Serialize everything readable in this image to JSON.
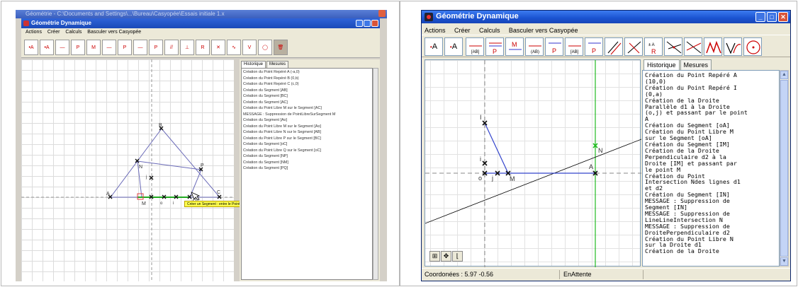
{
  "left": {
    "outer_title": "Géométrie - C:\\Documents and Settings\\...\\Bureau\\Casyopée\\Essais initiale 1.x",
    "window_title": "Géométrie Dynamique",
    "menu": [
      "Actions",
      "Créer",
      "Calculs",
      "Basculer vers Casyopée"
    ],
    "tabs": [
      "Historique",
      "Mesures"
    ],
    "history": [
      "Création du Point Repéré A (-a,0)",
      "Création du Point Repéré B (0,b)",
      "Création du Point Repéré C (c,0)",
      "Création du Segment [AB]",
      "Création du Segment [BC]",
      "Création du Segment [AC]",
      "Création du Point Libre M sur le Segment [AC]",
      "MESSAGE : Suppression de PointLibreSurSegment M",
      "Création du Segment [Ao]",
      "Création du Point Libre M sur le Segment [Ao]",
      "Création du Point Libre N sur le Segment [AB]",
      "Création du Point Libre P sur le Segment [BC]",
      "Création du Segment [oC]",
      "Création du Point Libre Q sur le Segment [oC]",
      "Création du Segment [NP]",
      "Création du Segment [NM]",
      "Création du Segment [PQ]"
    ],
    "tooltip": "Créer un Segment : entre le Point M et ... Choisissez le second Point",
    "points": [
      "A",
      "B",
      "C",
      "M",
      "N",
      "P",
      "Q",
      "o",
      "i",
      "j"
    ]
  },
  "right": {
    "window_title": "Géométrie Dynamique",
    "menu": [
      "Actions",
      "Créer",
      "Calculs",
      "Basculer vers Casyopée"
    ],
    "tabs": [
      "Historique",
      "Mesures"
    ],
    "history": [
      "Création du Point Repéré A",
      "(10,0)",
      "Création du Point Repéré I",
      "(0,a)",
      "Création de la Droite",
      "Parallèle d1 à la Droite",
      "(o,j) et passant par le point",
      "A",
      "Création du Segment [oA]",
      "Création du Point Libre M",
      "sur le Segment [oA]",
      "Création du Segment [IM]",
      "Création de la Droite",
      "Perpendiculaire d2 à la",
      "Droite [IM] et passant par",
      "le point M",
      "Création du Point",
      "Intersection Ndes lignes d1",
      "et d2",
      "Création du Segment [IN]",
      "MESSAGE : Suppression de",
      "Segment [IN]",
      "MESSAGE : Suppression de",
      "LineLineIntersection N",
      "MESSAGE : Suppression de",
      "DroitePerpendiculaire d2",
      "Création du Point Libre N",
      "sur la Droite d1",
      "Création de la Droite"
    ],
    "points": {
      "I": "I",
      "i": "i",
      "o": "o",
      "j": "j",
      "M": "M",
      "A": "A",
      "N": "N"
    },
    "status": {
      "coords": "Coordonées : 5.97 -0.56",
      "state": "EnAttente"
    }
  },
  "colors": {
    "xp_blue": "#1a52d0",
    "accent_red": "#cc0000",
    "line_green": "#22bb22",
    "segment_blue": "#3344cc"
  }
}
